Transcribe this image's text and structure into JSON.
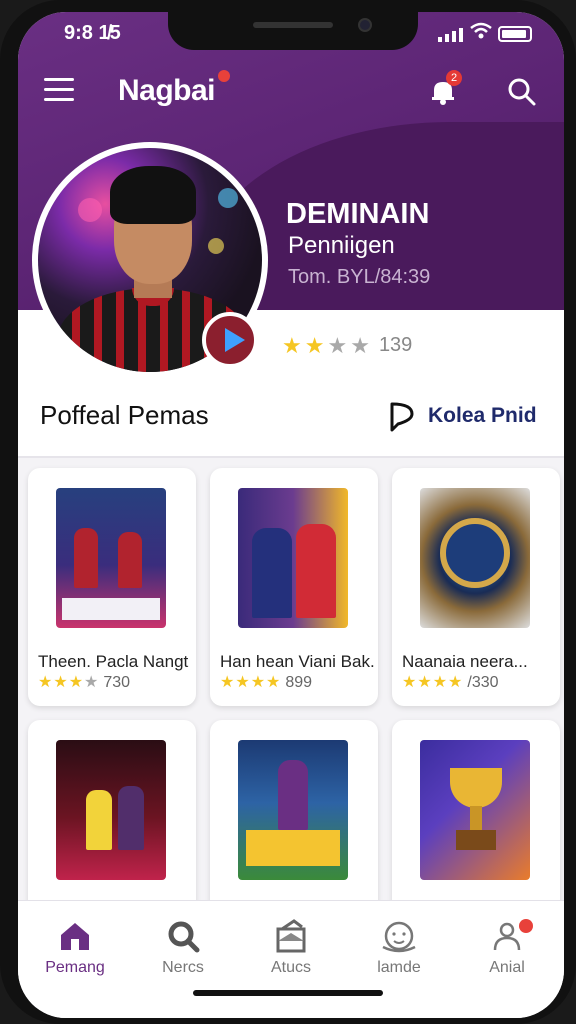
{
  "status_bar": {
    "time": "9:8 1̸5"
  },
  "topbar": {
    "brand": "Nagbai",
    "notification_count": "2"
  },
  "profile": {
    "name": "DEMINAIN",
    "subtitle": "Penniigen",
    "meta": "Tom. BYL/84:39",
    "rating": 2.5,
    "rating_count": "139"
  },
  "section": {
    "title": "Poffeal Pemas",
    "action_label": "Kolea Pnid"
  },
  "products": [
    {
      "title": "Theen. Pacla Nangt",
      "rating": 3.5,
      "count": "730"
    },
    {
      "title": "Han hean Viani Bak.",
      "rating": 4,
      "count": "899"
    },
    {
      "title": "Naanaia neera...",
      "rating": 4,
      "count": "/330"
    },
    {
      "title": "",
      "rating": 0,
      "count": ""
    },
    {
      "title": "",
      "rating": 0,
      "count": ""
    },
    {
      "title": "",
      "rating": 0,
      "count": ""
    }
  ],
  "nav": [
    {
      "label": "Pemang",
      "icon": "home-icon",
      "active": true
    },
    {
      "label": "Nercs",
      "icon": "search-icon",
      "active": false
    },
    {
      "label": "Atucs",
      "icon": "box-icon",
      "active": false
    },
    {
      "label": "lamde",
      "icon": "baby-face-icon",
      "active": false
    },
    {
      "label": "Anial",
      "icon": "profile-icon",
      "active": false
    }
  ],
  "colors": {
    "brand": "#6a2f83",
    "star": "#f5c623",
    "accent_red": "#e8413a"
  }
}
